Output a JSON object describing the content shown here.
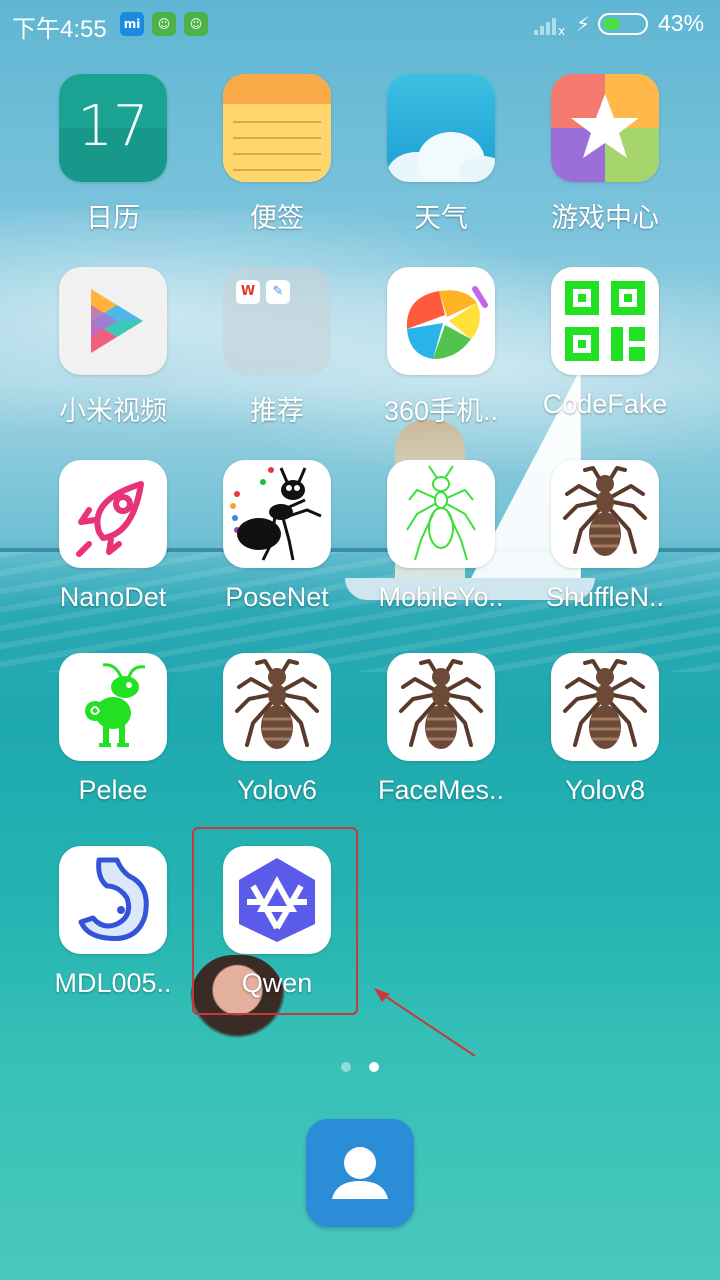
{
  "status_bar": {
    "time": "下午4:55",
    "notifications": [
      "mi-icon",
      "android-icon",
      "android-icon"
    ],
    "battery_percent": "43%",
    "battery_level": 0.43,
    "battery_fill_color": "#4be04b"
  },
  "apps": [
    {
      "label": "日历",
      "icon": "calendar-icon",
      "day": "17"
    },
    {
      "label": "便签",
      "icon": "notes-icon"
    },
    {
      "label": "天气",
      "icon": "weather-icon"
    },
    {
      "label": "游戏中心",
      "icon": "game-center-icon"
    },
    {
      "label": "小米视频",
      "icon": "video-icon"
    },
    {
      "label": "推荐",
      "icon": "folder-icon",
      "folder_apps": [
        "W",
        "✎"
      ]
    },
    {
      "label": "360手机..",
      "icon": "360-store-icon"
    },
    {
      "label": "CodeFake",
      "icon": "qr-code-icon"
    },
    {
      "label": "NanoDet",
      "icon": "rocket-icon"
    },
    {
      "label": "PoseNet",
      "icon": "ant-icon"
    },
    {
      "label": "MobileYo..",
      "icon": "green-ant-icon"
    },
    {
      "label": "ShuffleN..",
      "icon": "ant-icon"
    },
    {
      "label": "Pelee",
      "icon": "green-insect-icon"
    },
    {
      "label": "Yolov6",
      "icon": "ant-icon"
    },
    {
      "label": "FaceMes..",
      "icon": "ant-icon"
    },
    {
      "label": "Yolov8",
      "icon": "ant-icon"
    },
    {
      "label": "MDL005..",
      "icon": "stomach-icon"
    },
    {
      "label": "Qwen",
      "icon": "qwen-icon"
    }
  ],
  "page_indicator": {
    "pages": 2,
    "current": 2
  },
  "dock": [
    {
      "icon": "contacts-icon"
    }
  ],
  "colors": {
    "highlight": "#c9383a",
    "accent_green": "#22e022",
    "qwen": "#5b5bea"
  }
}
